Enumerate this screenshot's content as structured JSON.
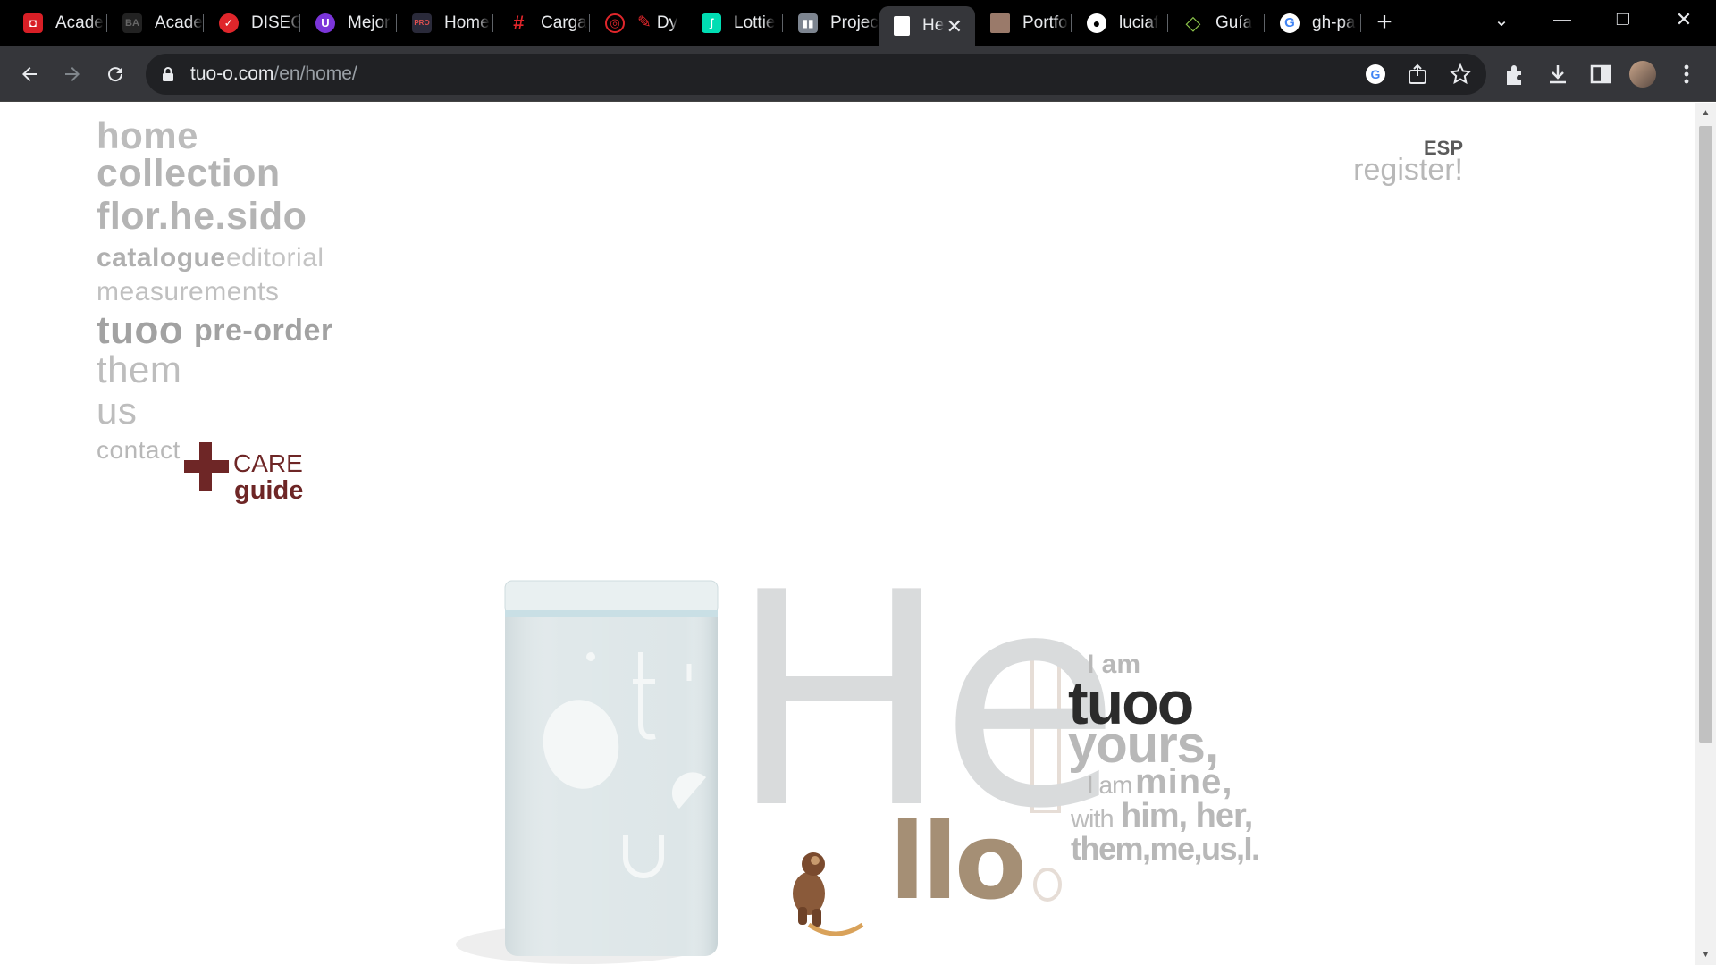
{
  "browser": {
    "tabs": [
      {
        "title": "Acade",
        "icon": "red-square-icon",
        "color": "#d81f26"
      },
      {
        "title": "Acade",
        "icon": "ba-icon",
        "color": "#222222"
      },
      {
        "title": "DISEG",
        "icon": "shield-icon",
        "color": "#e0262b"
      },
      {
        "title": "Mejor",
        "icon": "purple-u-icon",
        "color": "#7b35d9"
      },
      {
        "title": "Home",
        "icon": "procad-icon",
        "color": "#2a2a3a"
      },
      {
        "title": "Carga",
        "icon": "hashtag-red-icon",
        "color": "#e0262b"
      },
      {
        "title": "Dy",
        "icon": "dribbble-icon",
        "color": "#e0262b"
      },
      {
        "title": "Lottie",
        "icon": "lottie-icon",
        "color": "#00ddb3"
      },
      {
        "title": "Projec",
        "icon": "trello-icon",
        "color": "#7d8590"
      },
      {
        "title": "He",
        "icon": "page-icon",
        "color": "#ffffff"
      },
      {
        "title": "Portfo",
        "icon": "avatar-icon",
        "color": "#9a7a6a"
      },
      {
        "title": "luciaf",
        "icon": "github-icon",
        "color": "#ffffff"
      },
      {
        "title": "Guía",
        "icon": "green-diamond-icon",
        "color": "#8bc34a"
      },
      {
        "title": "gh-pa",
        "icon": "google-icon",
        "color": "#4285f4"
      }
    ],
    "active_tab_index": 9,
    "url_host": "tuo-o.com",
    "url_path": "/en/home/"
  },
  "nav": {
    "home": "home",
    "collection": "collection",
    "florhesido": "flor.he.sido",
    "catalogue": "catalogue",
    "editorial": "editorial",
    "measurements": "measurements",
    "tuoo": "tuoo",
    "preorder": "pre-order",
    "them": "them",
    "us": "us",
    "contact": "contact"
  },
  "care": {
    "line1": "CARE",
    "line2": "guide"
  },
  "header": {
    "lang": "ESP",
    "register": "register!"
  },
  "hero": {
    "he": "He",
    "llo": "llo",
    "tagline": {
      "i_am": "I am",
      "tuoo": "tuoo",
      "yours": "yours,",
      "i_am2": "I am",
      "mine": "mine,",
      "with": "with",
      "him_her": "him, her,",
      "them_me": "them,me,us,I."
    }
  },
  "colors": {
    "nav_grey": "#bfbfbf",
    "nav_dark": "#a8a8a8",
    "care_red": "#6e2626",
    "hello_grey": "#d9dbdc",
    "llo_brown": "#a58f75",
    "tuoo_dark": "#2b2b2b"
  }
}
